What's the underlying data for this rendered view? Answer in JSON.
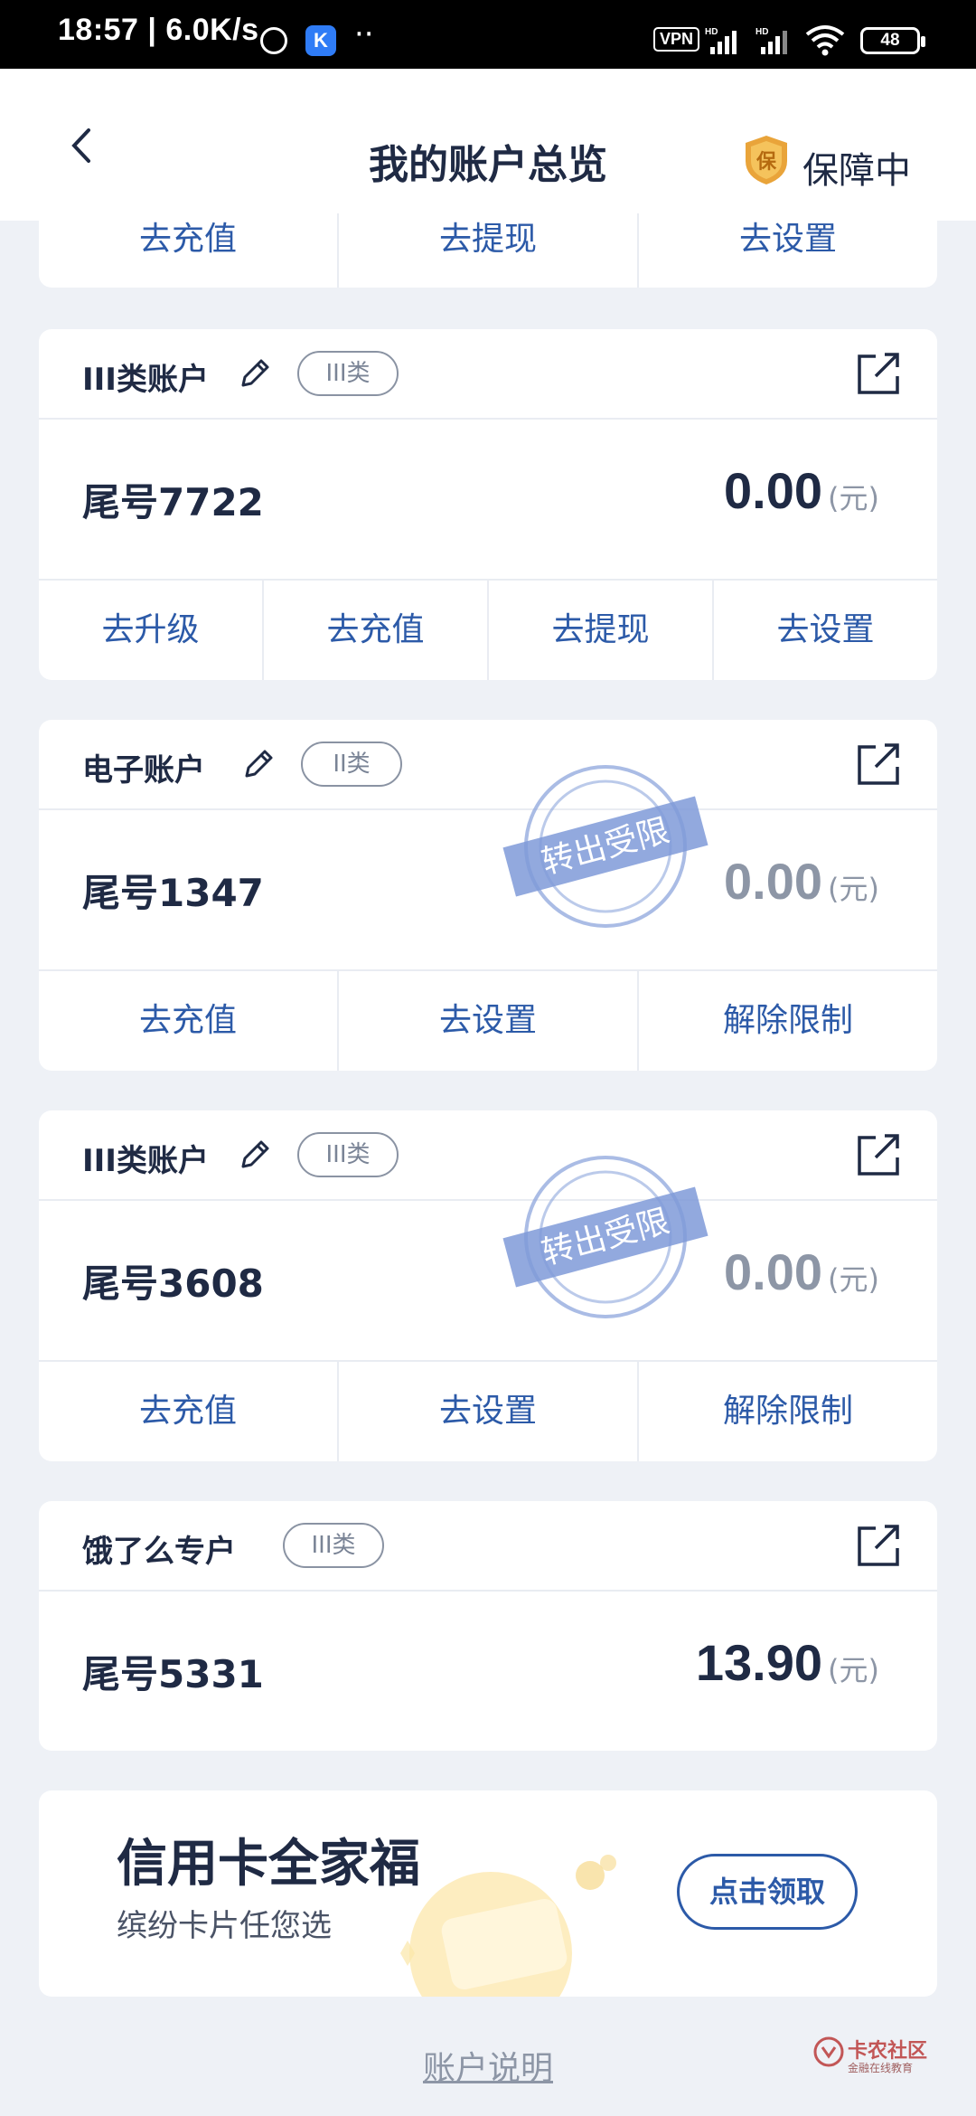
{
  "status_bar": {
    "time": "18:57 | 6.0K/s",
    "app_badge": "K",
    "dots": "··",
    "vpn": "VPN",
    "battery": "48"
  },
  "header": {
    "title": "我的账户总览",
    "guard_badge": "保",
    "guard_text": "保障中"
  },
  "top_partial_actions": [
    "去充值",
    "去提现",
    "去设置"
  ],
  "cards": [
    {
      "name": "III类账户",
      "tag": "III类",
      "account": "尾号7722",
      "amount": "0.00",
      "unit": "(元)",
      "restricted": false,
      "actions": [
        "去升级",
        "去充值",
        "去提现",
        "去设置"
      ]
    },
    {
      "name": "电子账户",
      "tag": "II类",
      "account": "尾号1347",
      "amount": "0.00",
      "unit": "(元)",
      "restricted": true,
      "stamp_text": "转出受限",
      "actions": [
        "去充值",
        "去设置",
        "解除限制"
      ]
    },
    {
      "name": "III类账户",
      "tag": "III类",
      "account": "尾号3608",
      "amount": "0.00",
      "unit": "(元)",
      "restricted": true,
      "stamp_text": "转出受限",
      "actions": [
        "去充值",
        "去设置",
        "解除限制"
      ]
    },
    {
      "name": "饿了么专户",
      "tag": "III类",
      "account": "尾号5331",
      "amount": "13.90",
      "unit": "(元)",
      "restricted": false,
      "actions": []
    }
  ],
  "banner": {
    "title": "信用卡全家福",
    "subtitle": "缤纷卡片任您选",
    "button": "点击领取"
  },
  "footer": {
    "link": "账户说明"
  },
  "watermark": {
    "text": "卡农社区",
    "sub": "金融在线教育"
  },
  "colors": {
    "primary_text": "#1f2a44",
    "action_blue": "#2c5aa8",
    "muted": "#8d96a6",
    "background": "#eef1f6",
    "stamp": "#6f8fd6"
  }
}
